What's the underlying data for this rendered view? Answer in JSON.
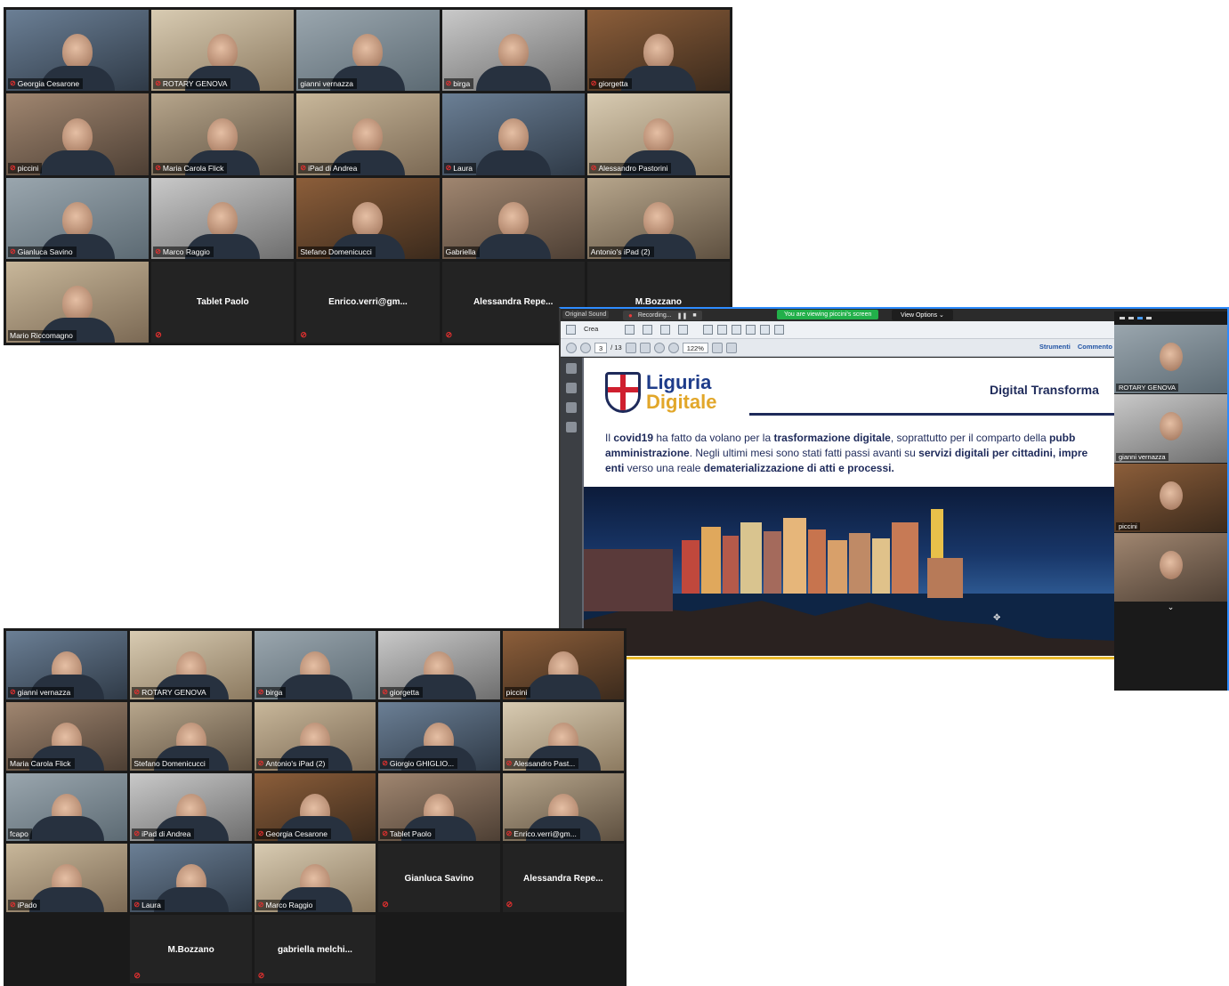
{
  "grid1": {
    "tiles": [
      {
        "name": "Georgia Cesarone",
        "muted": true,
        "video": true
      },
      {
        "name": "ROTARY GENOVA",
        "muted": true,
        "video": true
      },
      {
        "name": "gianni vernazza",
        "muted": false,
        "video": true,
        "active": true
      },
      {
        "name": "birga",
        "muted": true,
        "video": true
      },
      {
        "name": "giorgetta",
        "muted": true,
        "video": true
      },
      {
        "name": "piccini",
        "muted": true,
        "video": true
      },
      {
        "name": "Maria Carola Flick",
        "muted": true,
        "video": true
      },
      {
        "name": "iPad di Andrea",
        "muted": true,
        "video": true
      },
      {
        "name": "Laura",
        "muted": true,
        "video": true
      },
      {
        "name": "Alessandro Pastorini",
        "muted": true,
        "video": true
      },
      {
        "name": "Gianluca Savino",
        "muted": true,
        "video": true
      },
      {
        "name": "Marco Raggio",
        "muted": true,
        "video": true
      },
      {
        "name": "Stefano Domenicucci",
        "muted": false,
        "video": true
      },
      {
        "name": "Gabriella",
        "muted": false,
        "video": true
      },
      {
        "name": "Antonio's iPad (2)",
        "muted": false,
        "video": true
      },
      {
        "name": "Mario Riccomagno",
        "muted": false,
        "video": true
      },
      {
        "name": "Tablet Paolo",
        "muted": true,
        "video": false
      },
      {
        "name": "Enrico.verri@gm...",
        "muted": true,
        "video": false
      },
      {
        "name": "Alessandra Repe...",
        "muted": true,
        "video": false
      },
      {
        "name": "M.Bozzano",
        "muted": true,
        "video": false
      }
    ]
  },
  "grid2": {
    "tiles": [
      {
        "name": "gianni vernazza",
        "muted": true,
        "video": true
      },
      {
        "name": "ROTARY GENOVA",
        "muted": true,
        "video": true
      },
      {
        "name": "birga",
        "muted": true,
        "video": true
      },
      {
        "name": "giorgetta",
        "muted": true,
        "video": true
      },
      {
        "name": "piccini",
        "muted": false,
        "video": true,
        "active": true
      },
      {
        "name": "Maria Carola Flick",
        "muted": false,
        "video": true
      },
      {
        "name": "Stefano Domenicucci",
        "muted": false,
        "video": true
      },
      {
        "name": "Antonio's iPad (2)",
        "muted": true,
        "video": true
      },
      {
        "name": "Giorgio GHIGLIO...",
        "muted": true,
        "video": true
      },
      {
        "name": "Alessandro Past...",
        "muted": true,
        "video": true
      },
      {
        "name": "fcapo",
        "muted": false,
        "video": true
      },
      {
        "name": "iPad di Andrea",
        "muted": true,
        "video": true
      },
      {
        "name": "Georgia Cesarone",
        "muted": true,
        "video": true
      },
      {
        "name": "Tablet Paolo",
        "muted": true,
        "video": true
      },
      {
        "name": "Enrico.verri@gm...",
        "muted": true,
        "video": true
      },
      {
        "name": "iPado",
        "muted": true,
        "video": true
      },
      {
        "name": "Laura",
        "muted": true,
        "video": true
      },
      {
        "name": "Marco Raggio",
        "muted": true,
        "video": true
      },
      {
        "name": "Gianluca Savino",
        "muted": true,
        "video": false
      },
      {
        "name": "Alessandra Repe...",
        "muted": true,
        "video": false
      },
      {
        "name": "",
        "empty": true
      },
      {
        "name": "M.Bozzano",
        "muted": true,
        "video": false
      },
      {
        "name": "gabriella  melchi...",
        "muted": true,
        "video": false
      },
      {
        "name": "",
        "empty": true
      },
      {
        "name": "",
        "empty": true
      }
    ]
  },
  "share": {
    "original_sound": "Original Sound",
    "recording": "Recording...",
    "viewing_banner": "You are viewing piccini's screen",
    "view_options": "View Options ⌄",
    "crea": "Crea",
    "page_current": "3",
    "page_total": "/ 13",
    "zoom": "122%",
    "strumenti": "Strumenti",
    "commento": "Commento",
    "logo_line1": "Liguria",
    "logo_line2": "Digitale",
    "slide_title": "Digital Transforma",
    "sidebar_names": [
      "ROTARY GENOVA",
      "gianni vernazza",
      "piccini",
      ""
    ]
  },
  "colors": {
    "accent": "#2d8cff",
    "active_speaker": "#d7e33a",
    "muted": "#e3302f"
  }
}
